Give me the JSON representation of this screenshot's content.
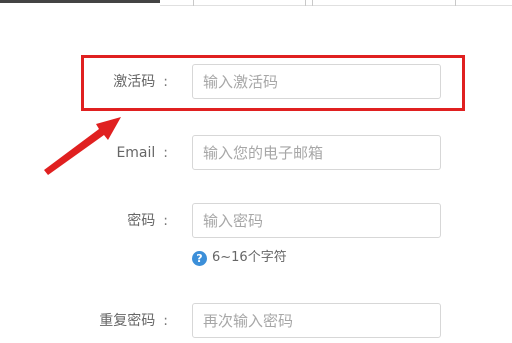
{
  "form": {
    "activation_code": {
      "label": "激活码",
      "colon": ":",
      "placeholder": "输入激活码"
    },
    "email": {
      "label": "Email",
      "colon": ":",
      "placeholder": "输入您的电子邮箱"
    },
    "password": {
      "label": "密码",
      "colon": ":",
      "placeholder": "输入密码",
      "hint_icon": "?",
      "hint": "6~16个字符"
    },
    "confirm_password": {
      "label": "重复密码",
      "colon": ":",
      "placeholder": "再次输入密码"
    }
  },
  "annotation": {
    "highlight_color": "#e02020",
    "arrow_color": "#e02020"
  },
  "icons": {
    "hint": "question-circle-icon"
  }
}
